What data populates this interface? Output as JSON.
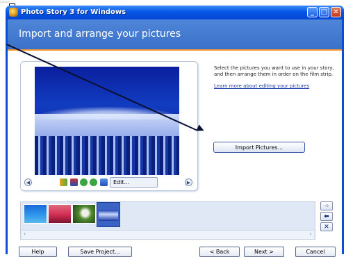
{
  "window": {
    "title": "Photo Story 3 for Windows",
    "controls": {
      "minimize": "_",
      "maximize": "□",
      "close": "✕"
    }
  },
  "header": {
    "title": "Import and arrange your pictures"
  },
  "instructions": {
    "text": "Select the pictures you want to use in your story, and then arrange them in order on the film strip.",
    "learn_link": "Learn more about editing your pictures"
  },
  "buttons": {
    "import": "Import Pictures...",
    "edit": "Edit...",
    "help": "Help",
    "save_project": "Save Project...",
    "back": "< Back",
    "next": "Next >",
    "cancel": "Cancel"
  },
  "filmstrip": {
    "thumbnails": [
      "blue-water-photo",
      "sunset-photo",
      "green-plant-photo",
      "snowy-forest-photo"
    ],
    "selected_index": 3
  },
  "colors": {
    "title_bar": "#0757e6",
    "header_band": "#4a7fd4",
    "accent_line": "#ff9b2f",
    "link": "#1a3caa"
  }
}
